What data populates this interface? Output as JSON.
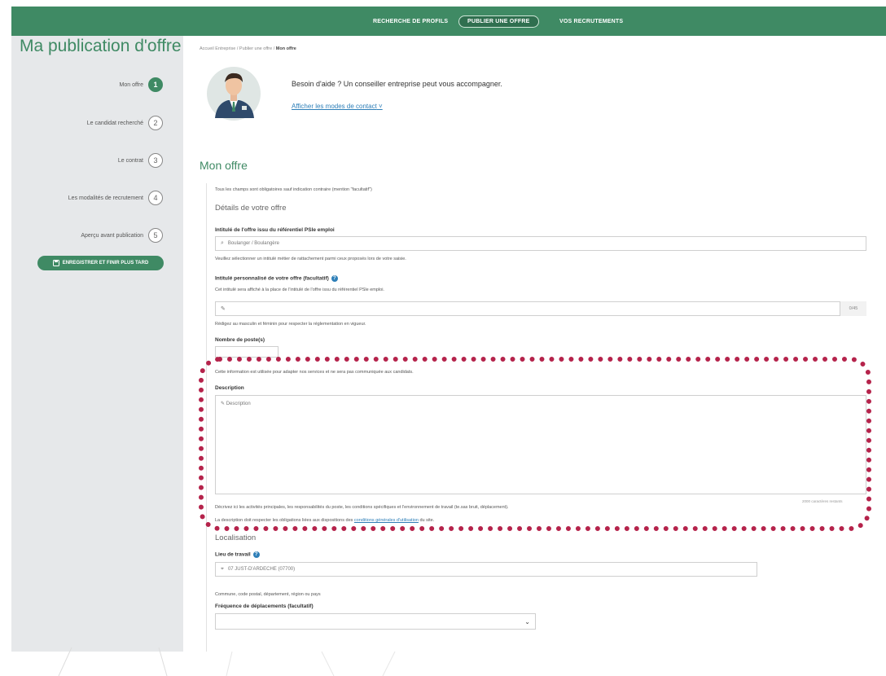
{
  "nav": {
    "items": [
      {
        "label": "RECHERCHE DE PROFILS",
        "active": false
      },
      {
        "label": "PUBLIER UNE OFFRE",
        "active": true
      },
      {
        "label": "VOS RECRUTEMENTS",
        "active": false
      }
    ]
  },
  "sidebar": {
    "title": "Ma publication d'offre",
    "steps": [
      {
        "label": "Mon offre",
        "number": "1",
        "active": true
      },
      {
        "label": "Le candidat recherché",
        "number": "2",
        "active": false
      },
      {
        "label": "Le contrat",
        "number": "3",
        "active": false
      },
      {
        "label": "Les modalités de recrutement",
        "number": "4",
        "active": false
      },
      {
        "label": "Aperçu avant publication",
        "number": "5",
        "active": false
      }
    ],
    "save_label": "ENREGISTRER ET FINIR PLUS TARD"
  },
  "breadcrumb": {
    "prefix": "Accueil Entreprise / Publier une offre / ",
    "current": "Mon offre"
  },
  "help": {
    "text": "Besoin d'aide ? Un conseiller entreprise peut vous accompagner.",
    "link": "Afficher les modes de contact"
  },
  "form": {
    "section_title": "Mon offre",
    "required_note": "Tous les champs sont obligatoires sauf indication contraire (mention \"facultatif\")",
    "details_heading": "Détails de votre offre",
    "intitule_label": "Intitulé de l'offre issu du référentiel PSle emploi",
    "intitule_value": "Boulanger / Boulangère",
    "intitule_help": "Veuillez sélectionner un intitulé métier de rattachement parmi ceux proposés lors de votre saisie.",
    "perso_label": "Intitulé personnalisé de votre offre (facultatif)",
    "perso_help": "Cet intitulé sera affiché à la place de l'intitulé de l'offre issu du référentiel PSle emploi.",
    "perso_counter": "0/45",
    "perso_note": "Rédigez au masculin et féminin pour respecter la réglementation en vigueur.",
    "postes_label": "Nombre de poste(s)",
    "postes_help": "Cette information est utilisée pour adapter nos services et ne sera pas communiquée aux candidats.",
    "description_label": "Description",
    "description_placeholder": "Description",
    "description_counter": "2000 caractères restants",
    "description_help": "Décrivez ici les activités principales, les responsabilités du poste, les conditions spécifiques et l'environnement de travail (te.sas bruit, déplacement).",
    "description_rules_prefix": "La description doit respecter les obligations liées aux dispositions des ",
    "description_rules_link": "conditions générales d'utilisation",
    "description_rules_suffix": " du site.",
    "localisation_heading": "Localisation",
    "lieu_label": "Lieu de travail",
    "lieu_value": "07 JUST-D'ARDECHE (07700)",
    "lieu_help": "Commune, code postal, département, région ou pays",
    "frequence_label": "Fréquence de déplacements (facultatif)"
  },
  "colors": {
    "brand_green": "#3f8a64",
    "highlight": "#b5234b",
    "link_blue": "#2e7fb8"
  },
  "icons": {
    "chevron": "chevron-down-icon",
    "info": "info-icon",
    "save": "save-icon"
  }
}
